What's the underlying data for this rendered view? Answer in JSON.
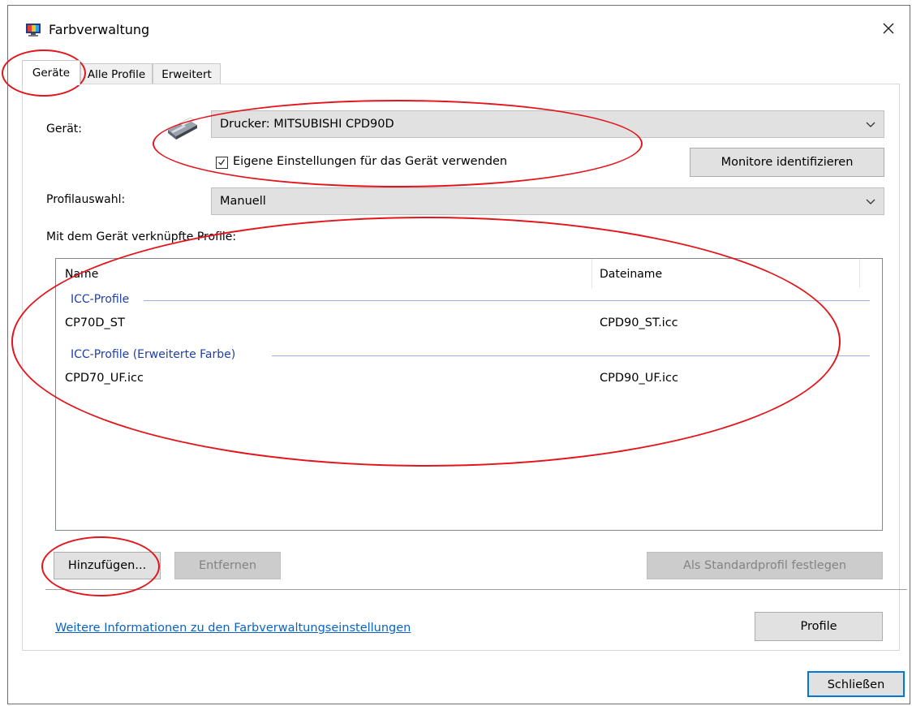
{
  "window": {
    "title": "Farbverwaltung",
    "close_symbol": "✕"
  },
  "tabs": [
    {
      "label": "Geräte",
      "active": true
    },
    {
      "label": "Alle Profile",
      "active": false
    },
    {
      "label": "Erweitert",
      "active": false
    }
  ],
  "device": {
    "label": "Gerät:",
    "icon": "printer-icon",
    "selected": "Drucker: MITSUBISHI CPD90D",
    "use_own_settings_label": "Eigene Einstellungen für das Gerät verwenden",
    "use_own_settings_checked": true,
    "identify_button": "Monitore identifizieren"
  },
  "profile_selection": {
    "label": "Profilauswahl:",
    "selected": "Manuell"
  },
  "profiles": {
    "heading": "Mit dem Gerät verknüpfte Profile:",
    "columns": [
      "Name",
      "Dateiname"
    ],
    "groups": [
      {
        "title": "ICC-Profile",
        "rows": [
          {
            "name": "CP70D_ST",
            "file": "CPD90_ST.icc"
          }
        ]
      },
      {
        "title": "ICC-Profile (Erweiterte Farbe)",
        "rows": [
          {
            "name": "CPD70_UF.icc",
            "file": "CPD90_UF.icc"
          }
        ]
      }
    ]
  },
  "buttons": {
    "add": "Hinzufügen...",
    "remove": "Entfernen",
    "set_default": "Als Standardprofil festlegen",
    "profiles": "Profile",
    "close": "Schließen"
  },
  "link_text": "Weitere Informationen zu den Farbverwaltungseinstellungen",
  "colors": {
    "accent": "#0b62c4",
    "group_text": "#1e3ea8",
    "annotation": "#e4141b"
  }
}
